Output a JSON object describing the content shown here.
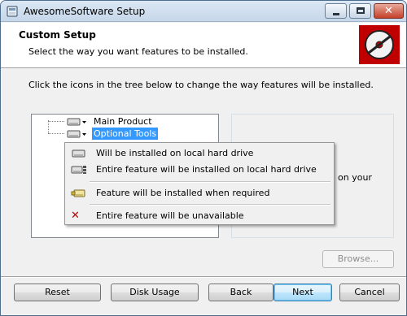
{
  "window": {
    "title": "AwesomeSoftware Setup",
    "close_glyph": "✕"
  },
  "header": {
    "title": "Custom Setup",
    "subtitle": "Select the way you want features to be installed."
  },
  "instruction": "Click the icons in the tree below to change the way features will be installed.",
  "tree": {
    "items": [
      {
        "label": "Main Product",
        "selected": false,
        "icon": "hard-drive-icon"
      },
      {
        "label": "Optional Tools",
        "selected": true,
        "icon": "hard-drive-icon"
      }
    ]
  },
  "description": {
    "visible_fragment": "on your"
  },
  "context_menu": {
    "items": [
      {
        "label": "Will be installed on local hard drive",
        "icon": "hard-drive-icon"
      },
      {
        "label": "Entire feature will be installed on local hard drive",
        "icon": "hard-drive-tree-icon"
      },
      {
        "label": "Feature will be installed when required",
        "icon": "on-demand-install-icon"
      },
      {
        "label": "Entire feature will be unavailable",
        "icon": "unavailable-x-icon",
        "glyph": "✕"
      }
    ]
  },
  "buttons": {
    "browse": "Browse...",
    "reset": "Reset",
    "disk_usage": "Disk Usage",
    "back": "Back",
    "next": "Next",
    "cancel": "Cancel"
  },
  "colors": {
    "selection": "#3399ff",
    "brand_red": "#c00000",
    "default_button_border": "#3c7fb1"
  }
}
